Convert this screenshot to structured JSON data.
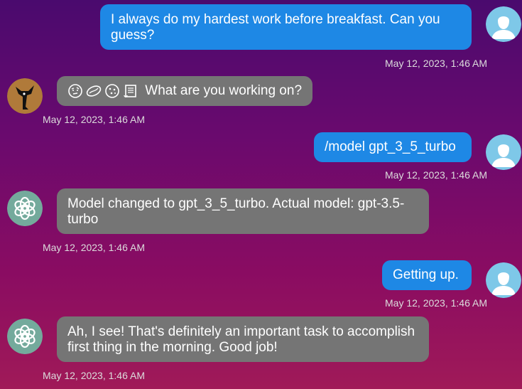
{
  "messages": [
    {
      "role": "user",
      "text": "I always do my hardest work before breakfast. Can you guess?",
      "time": "May 12, 2023, 1:46 AM",
      "avatar": "user-avatar"
    },
    {
      "role": "assistant",
      "emojis": [
        "face-with-raised-eyebrow-emoji",
        "bean-emoji",
        "cookie-emoji",
        "scroll-emoji"
      ],
      "text": "What are you working on?",
      "time": "May 12, 2023, 1:46 AM",
      "avatar": "fox-avatar"
    },
    {
      "role": "user",
      "text": "/model gpt_3_5_turbo",
      "time": "May 12, 2023, 1:46 AM",
      "avatar": "user-avatar"
    },
    {
      "role": "assistant",
      "text": "Model changed to gpt_3_5_turbo. Actual model: gpt-3.5-turbo",
      "time": "May 12, 2023, 1:46 AM",
      "avatar": "openai-avatar"
    },
    {
      "role": "user",
      "text": "Getting up.",
      "time": "May 12, 2023, 1:46 AM",
      "avatar": "user-avatar"
    },
    {
      "role": "assistant",
      "text": "Ah, I see! That's definitely an important task to accomplish first thing in the morning. Good job!",
      "time": "May 12, 2023, 1:46 AM",
      "avatar": "openai-avatar"
    }
  ],
  "colors": {
    "user_bubble": "#1e88e5",
    "bot_bubble": "#757575",
    "timestamp": "#dcdcdc",
    "openai_avatar_bg": "#74aa9c",
    "user_avatar_bg": "#7ec8e8"
  }
}
